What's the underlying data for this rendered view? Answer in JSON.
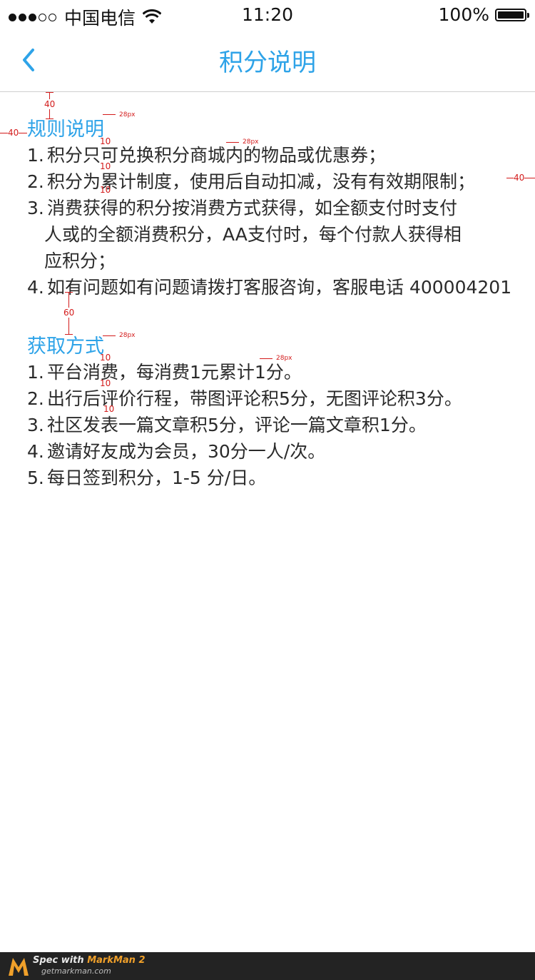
{
  "status_bar": {
    "carrier": "中国电信",
    "time": "11:20",
    "battery": "100%"
  },
  "nav": {
    "title": "积分说明",
    "back_icon": "chevron-left-icon"
  },
  "rules": {
    "title": "规则说明",
    "items": [
      {
        "num": "1.",
        "lines": [
          "积分只可兑换积分商城内的物品或优惠券；"
        ]
      },
      {
        "num": "2.",
        "lines": [
          "积分为累计制度，使用后自动扣减，没有有效期限制；"
        ]
      },
      {
        "num": "3.",
        "lines": [
          "消费获得的积分按消费方式获得，如全额支付时支付",
          "人或的全额消费积分，AA支付时，每个付款人获得相",
          "应积分；"
        ]
      },
      {
        "num": "4.",
        "lines": [
          "如有问题如有问题请拨打客服咨询，客服电话 400004201"
        ]
      }
    ]
  },
  "earn": {
    "title": "获取方式",
    "items": [
      {
        "num": "1.",
        "text": "平台消费，每消费1元累计1分。"
      },
      {
        "num": "2.",
        "text": "出行后评价行程，带图评论积5分，无图评论积3分。"
      },
      {
        "num": "3.",
        "text": "社区发表一篇文章积5分，评论一篇文章积1分。"
      },
      {
        "num": "4.",
        "text": "邀请好友成为会员，30分一人/次。"
      },
      {
        "num": "5.",
        "text": "每日签到积分，1-5 分/日。"
      }
    ]
  },
  "annotations": {
    "top_gap": "40",
    "left_margin": "40",
    "right_margin": "40",
    "section_gap": "60",
    "line_gap": "10",
    "font_size_28": "28px"
  },
  "footer": {
    "prefix": "Spec with ",
    "brand": "MarkMan 2",
    "url": "getmarkman.com"
  },
  "colors": {
    "accent": "#2ea3e8",
    "annotation": "#d31b1b",
    "footer_bg": "#232323"
  }
}
